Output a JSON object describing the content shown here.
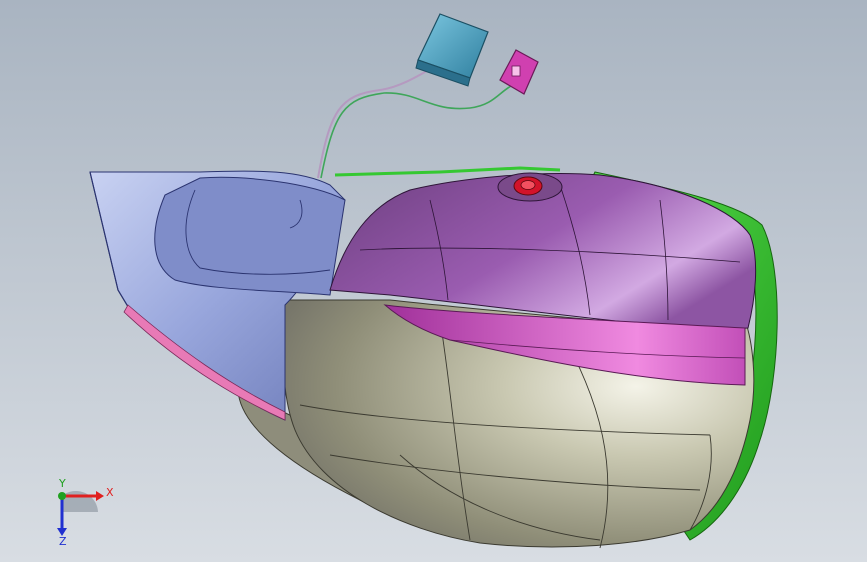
{
  "viewport": {
    "background_top": "#a9b4c1",
    "background_bottom": "#d8dde3"
  },
  "model": {
    "colors": {
      "body_purple": "#8a4f9a",
      "body_gray": "#a6a58c",
      "rim_green": "#35c832",
      "nose_blue": "#96a4d6",
      "accent_pink": "#e05ad0",
      "button_red": "#d2132a",
      "connector_cyan": "#4ea3c4",
      "connector_magenta": "#cf3aa8"
    }
  },
  "triad": {
    "x_label": "X",
    "y_label": "Y",
    "z_label": "Z",
    "x_color": "#e02020",
    "y_color": "#20a020",
    "z_color": "#2030d0"
  }
}
